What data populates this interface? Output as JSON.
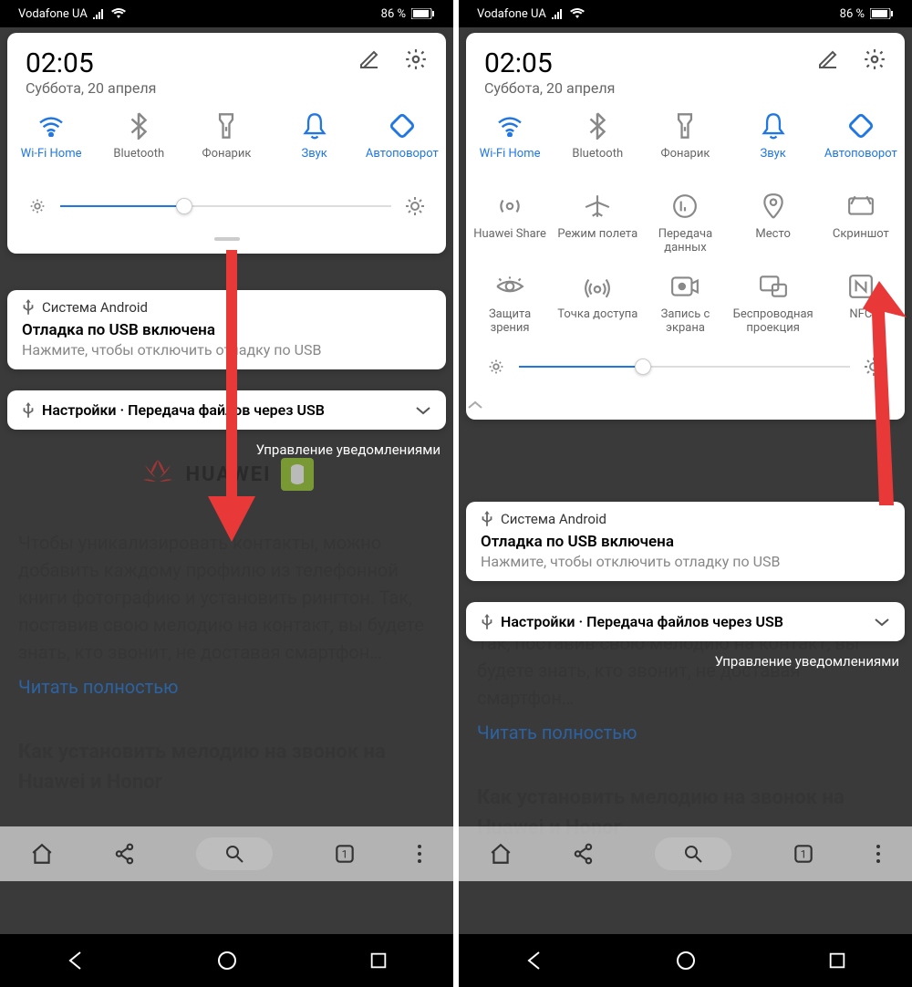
{
  "status": {
    "carrier": "Vodafone UA",
    "battery": "86 %"
  },
  "panel": {
    "time": "02:05",
    "date": "Суббота, 20 апреля"
  },
  "qsRow1": [
    {
      "name": "wifi",
      "label": "Wi-Fi Home",
      "active": true
    },
    {
      "name": "bt",
      "label": "Bluetooth",
      "active": false
    },
    {
      "name": "torch",
      "label": "Фонарик",
      "active": false
    },
    {
      "name": "sound",
      "label": "Звук",
      "active": true
    },
    {
      "name": "rotate",
      "label": "Автоповорот",
      "active": true
    }
  ],
  "qsRow2": [
    {
      "name": "share",
      "label": "Huawei Share"
    },
    {
      "name": "airplane",
      "label": "Режим полета"
    },
    {
      "name": "data",
      "label": "Передача данных"
    },
    {
      "name": "loc",
      "label": "Место"
    },
    {
      "name": "shot",
      "label": "Скриншот"
    }
  ],
  "qsRow3": [
    {
      "name": "eye",
      "label": "Защита зрения"
    },
    {
      "name": "hotspot",
      "label": "Точка доступа"
    },
    {
      "name": "rec",
      "label": "Запись с экрана"
    },
    {
      "name": "cast",
      "label": "Беспроводная проекция"
    },
    {
      "name": "nfc",
      "label": "NFC"
    }
  ],
  "notif1": {
    "app": "Система Android",
    "title": "Отладка по USB включена",
    "sub": "Нажмите, чтобы отключить отладку по USB"
  },
  "notif2": {
    "text": "Настройки · Передача файлов через USB"
  },
  "manage": "Управление уведомлениями",
  "bg": {
    "brand": "HUAWEI",
    "para": "Чтобы уникализировать контакты, можно добавить каждому профилю из телефонной книги фотографию и установить рингтон. Так, поставив свою мелодию на контакт, вы будете знать, кто звонит, не доставая смартфон…",
    "para2": "Так, поставив свою мелодию на контакт, вы будете знать, кто звонит, не доставая смартфон…",
    "readmore": "Читать полностью",
    "title": "Как установить мелодию на звонок на Huawei и Honor"
  }
}
